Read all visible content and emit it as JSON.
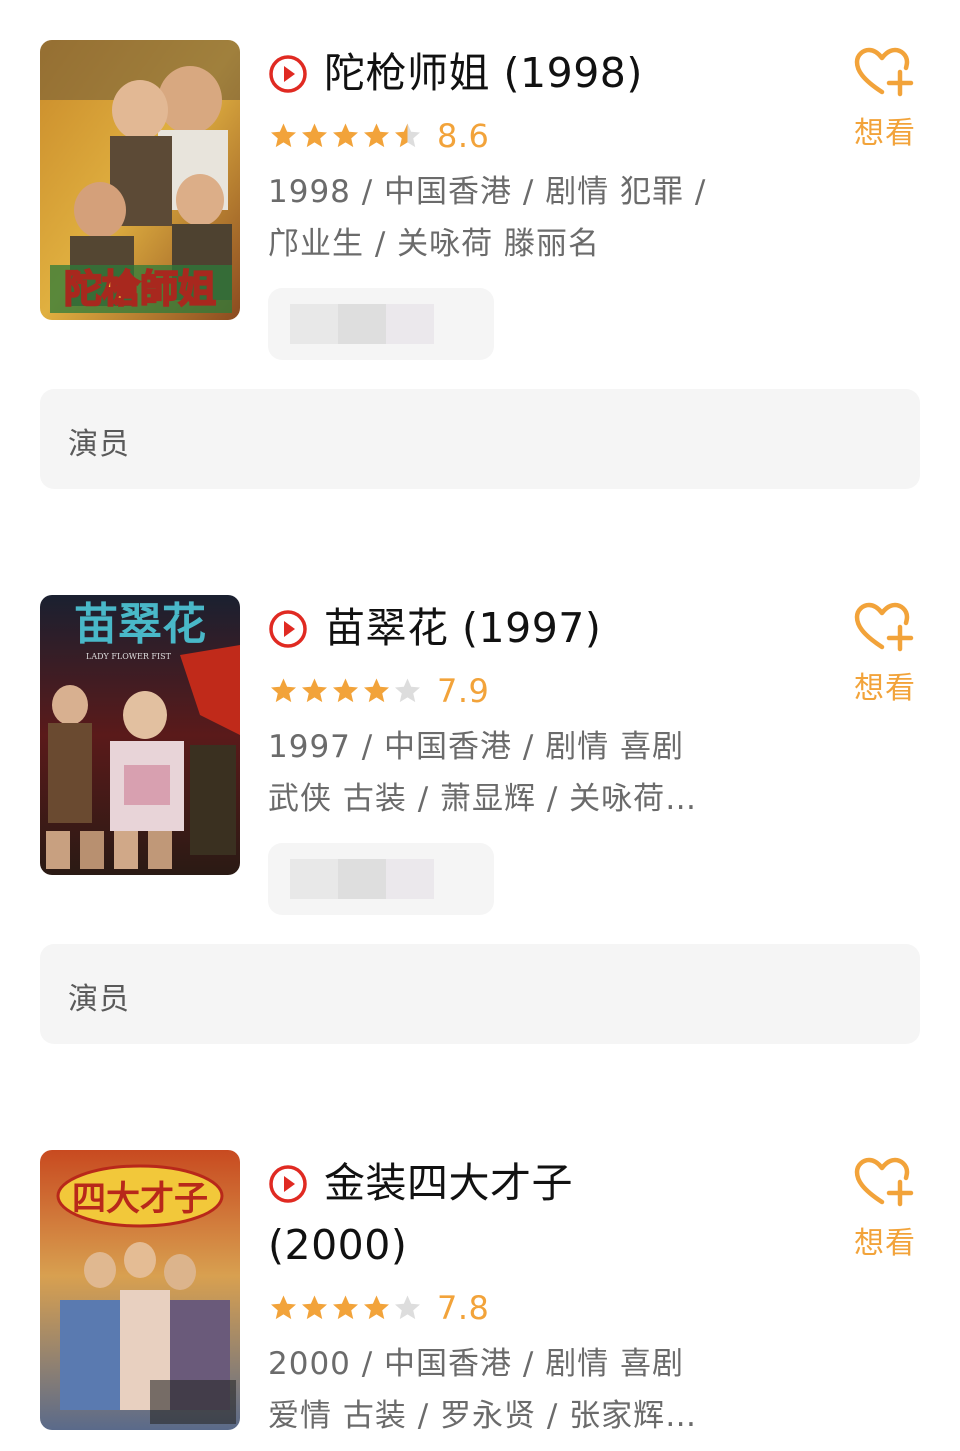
{
  "want_label": "想看",
  "cast_label": "演员",
  "colors": {
    "accent": "#f2a33a",
    "play_red": "#e02a22",
    "star_empty": "#dddddd",
    "meta_text": "#6b6b6b",
    "panel_bg": "#f5f5f5"
  },
  "items": [
    {
      "title": "陀枪师姐 (1998)",
      "rating_stars": 4.5,
      "score": "8.6",
      "meta_line1": "1998 / 中国香港 / 剧情 犯罪 /",
      "meta_line2": "邝业生 / 关咏荷 滕丽名",
      "poster_text": "陀槍師姐"
    },
    {
      "title": "苗翠花 (1997)",
      "rating_stars": 4,
      "score": "7.9",
      "meta_line1": "1997 / 中国香港 / 剧情 喜剧",
      "meta_line2": "武侠 古装 / 萧显辉 / 关咏荷…",
      "poster_text": "苗翠花",
      "poster_subtext": "LADY FLOWER FIST"
    },
    {
      "title": "金装四大才子",
      "title_line2": "(2000)",
      "rating_stars": 4,
      "score": "7.8",
      "meta_line1": "2000 / 中国香港 / 剧情 喜剧",
      "meta_line2": "爱情 古装 / 罗永贤 / 张家辉…",
      "poster_text": "四大才子"
    }
  ]
}
